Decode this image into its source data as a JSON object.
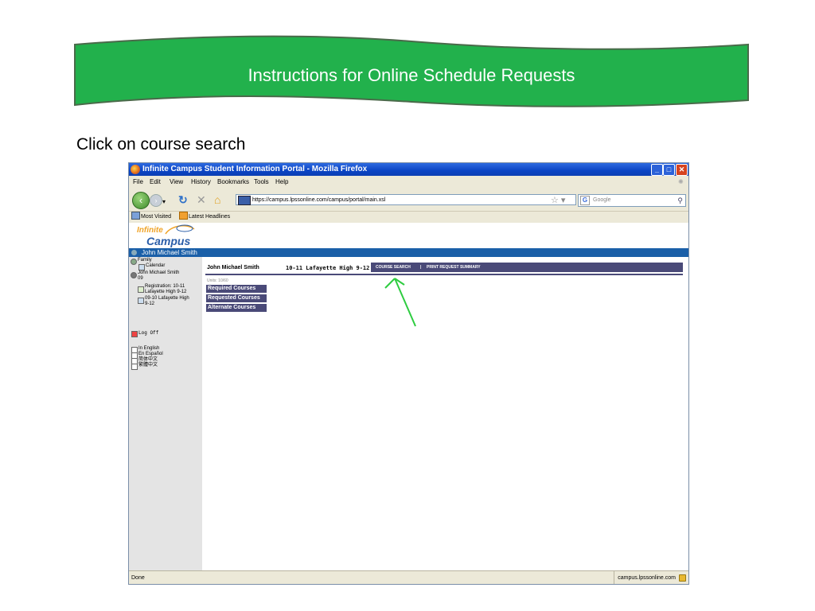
{
  "slide": {
    "title": "Instructions for Online Schedule Requests",
    "instruction": "Click on course search",
    "banner_color": "#22b14c"
  },
  "browser": {
    "title": "Infinite Campus Student Information Portal - Mozilla Firefox",
    "menu": [
      "File",
      "Edit",
      "View",
      "History",
      "Bookmarks",
      "Tools",
      "Help"
    ],
    "url": "https://campus.lpssonline.com/campus/portal/main.xsl",
    "search_placeholder": "Google",
    "bookmarks": [
      "Most Visited",
      "Latest Headlines"
    ],
    "status": "Done",
    "status_domain": "campus.lpssonline.com"
  },
  "portal": {
    "logo_line1": "Infinite",
    "logo_line2": "Campus",
    "user_name": "John Michael Smith",
    "sidebar": {
      "family": "Family",
      "calendar": "Calendar",
      "student": "John Michael Smith",
      "student_id": "09",
      "registration_1": "Registration: 10-11",
      "registration_2": "Lafayette High 9-12",
      "term_1": "09-10 Lafayette High",
      "term_2": "9-12",
      "logoff": "Log Off",
      "lang_en": "In English",
      "lang_es": "En Español",
      "lang_zh_s": "简体中文",
      "lang_zh_t": "繁體中文"
    },
    "student_name": "John Michael Smith",
    "school": "10-11 Lafayette High 9-12",
    "tabs": {
      "course_search": "COURSE SEARCH",
      "separator": "|",
      "print_summary": "PRINT REQUEST SUMMARY"
    },
    "units": "Units: 10/60",
    "course_buttons": [
      "Required Courses",
      "Requested Courses",
      "Alternate Courses"
    ],
    "accent_color": "#4a4a78",
    "bar_color": "#1a5fa8",
    "arrow_color": "#2ecc40"
  }
}
